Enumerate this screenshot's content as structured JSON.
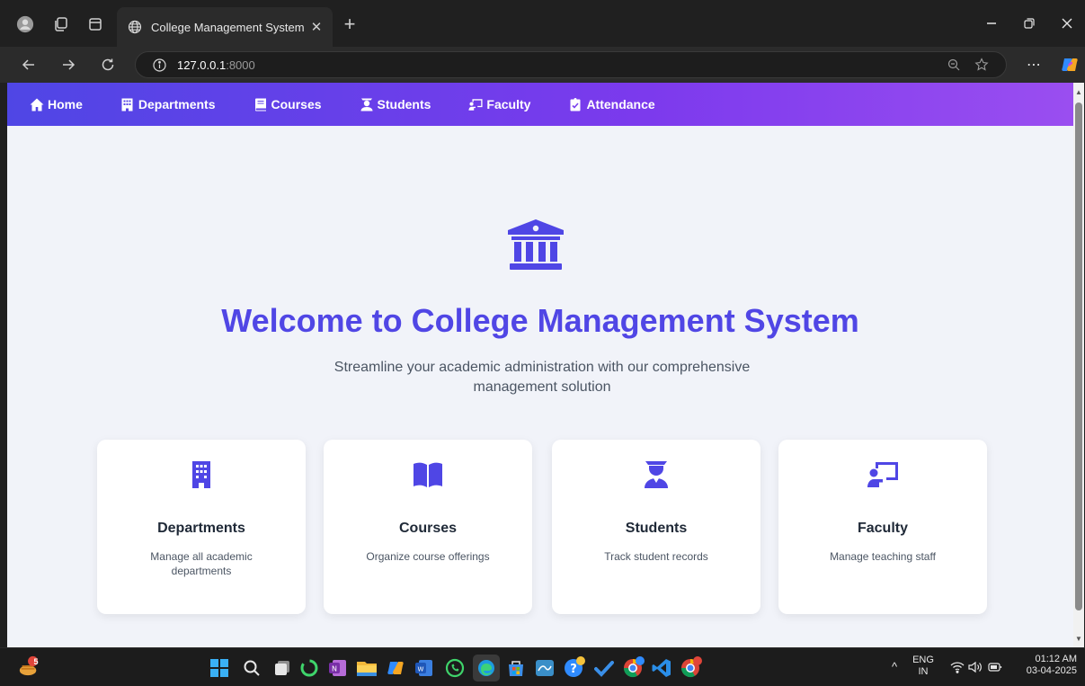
{
  "browser": {
    "tab_title": "College Management System",
    "url_host": "127.0.0.1",
    "url_port": ":8000"
  },
  "navbar": {
    "items": [
      {
        "label": "Home",
        "icon": "home-icon"
      },
      {
        "label": "Departments",
        "icon": "building-icon"
      },
      {
        "label": "Courses",
        "icon": "book-icon"
      },
      {
        "label": "Students",
        "icon": "graduate-icon"
      },
      {
        "label": "Faculty",
        "icon": "teacher-icon"
      },
      {
        "label": "Attendance",
        "icon": "clipboard-check-icon"
      }
    ]
  },
  "hero": {
    "icon": "university-icon",
    "title": "Welcome to College Management System",
    "subtitle": "Streamline your academic administration with our comprehensive management solution"
  },
  "cards": [
    {
      "title": "Departments",
      "description": "Manage all academic departments",
      "icon": "building-icon"
    },
    {
      "title": "Courses",
      "description": "Organize course offerings",
      "icon": "book-open-icon"
    },
    {
      "title": "Students",
      "description": "Track student records",
      "icon": "graduate-icon"
    },
    {
      "title": "Faculty",
      "description": "Manage teaching staff",
      "icon": "teacher-icon"
    }
  ],
  "taskbar": {
    "widget_badge": "5",
    "language_top": "ENG",
    "language_bottom": "IN",
    "time": "01:12 AM",
    "date": "03-04-2025"
  },
  "colors": {
    "primary": "#4f46e5",
    "navbar_end": "#9a4ef0",
    "page_background": "#f1f3f9"
  }
}
